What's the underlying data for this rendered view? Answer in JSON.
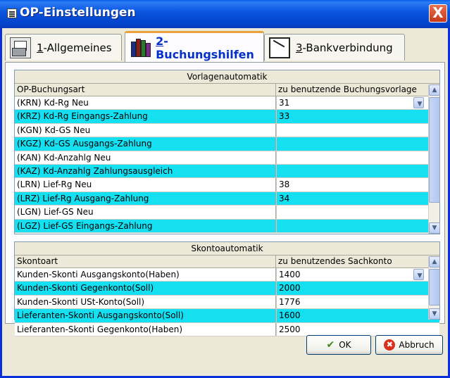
{
  "window": {
    "title": "OP-Einstellungen",
    "close_symbol": "X"
  },
  "tabs": [
    {
      "hotkey": "1",
      "label": "-Allgemeines"
    },
    {
      "hotkey": "2",
      "label": "-Buchungshilfen"
    },
    {
      "hotkey": "3",
      "label": "-Bankverbindung"
    }
  ],
  "vorlagen": {
    "section_title": "Vorlagenautomatik",
    "col1_header": "OP-Buchungsart",
    "col2_header": "zu benutzende Buchungsvorlage",
    "rows": [
      {
        "art": "(KRN) Kd-Rg Neu",
        "vorlage": "31"
      },
      {
        "art": "(KRZ) Kd-Rg Eingangs-Zahlung",
        "vorlage": "33"
      },
      {
        "art": "(KGN) Kd-GS Neu",
        "vorlage": ""
      },
      {
        "art": "(KGZ) Kd-GS Ausgangs-Zahlung",
        "vorlage": ""
      },
      {
        "art": "(KAN) Kd-Anzahlg Neu",
        "vorlage": ""
      },
      {
        "art": "(KAZ) Kd-Anzahlg Zahlungsausgleich",
        "vorlage": ""
      },
      {
        "art": "(LRN) Lief-Rg Neu",
        "vorlage": "38"
      },
      {
        "art": "(LRZ) Lief-Rg Ausgang-Zahlung",
        "vorlage": "34"
      },
      {
        "art": "(LGN) Lief-GS Neu",
        "vorlage": ""
      },
      {
        "art": "(LGZ) Lief-GS Eingangs-Zahlung",
        "vorlage": ""
      }
    ]
  },
  "skonto": {
    "section_title": "Skontoautomatik",
    "col1_header": "Skontoart",
    "col2_header": "zu benutzendes Sachkonto",
    "rows": [
      {
        "art": "Kunden-Skonti Ausgangskonto(Haben)",
        "konto": "1400"
      },
      {
        "art": "Kunden-Skonti Gegenkonto(Soll)",
        "konto": "2000"
      },
      {
        "art": "Kunden-Skonti USt-Konto(Soll)",
        "konto": "1776"
      },
      {
        "art": "Lieferanten-Skonti Ausgangskonto(Soll)",
        "konto": "1600"
      },
      {
        "art": "Lieferanten-Skonti Gegenkonto(Haben)",
        "konto": "2500"
      }
    ]
  },
  "buttons": {
    "ok": "OK",
    "cancel": "Abbruch"
  },
  "icons": {
    "ok": "check-icon",
    "cancel": "x-circle-icon"
  }
}
